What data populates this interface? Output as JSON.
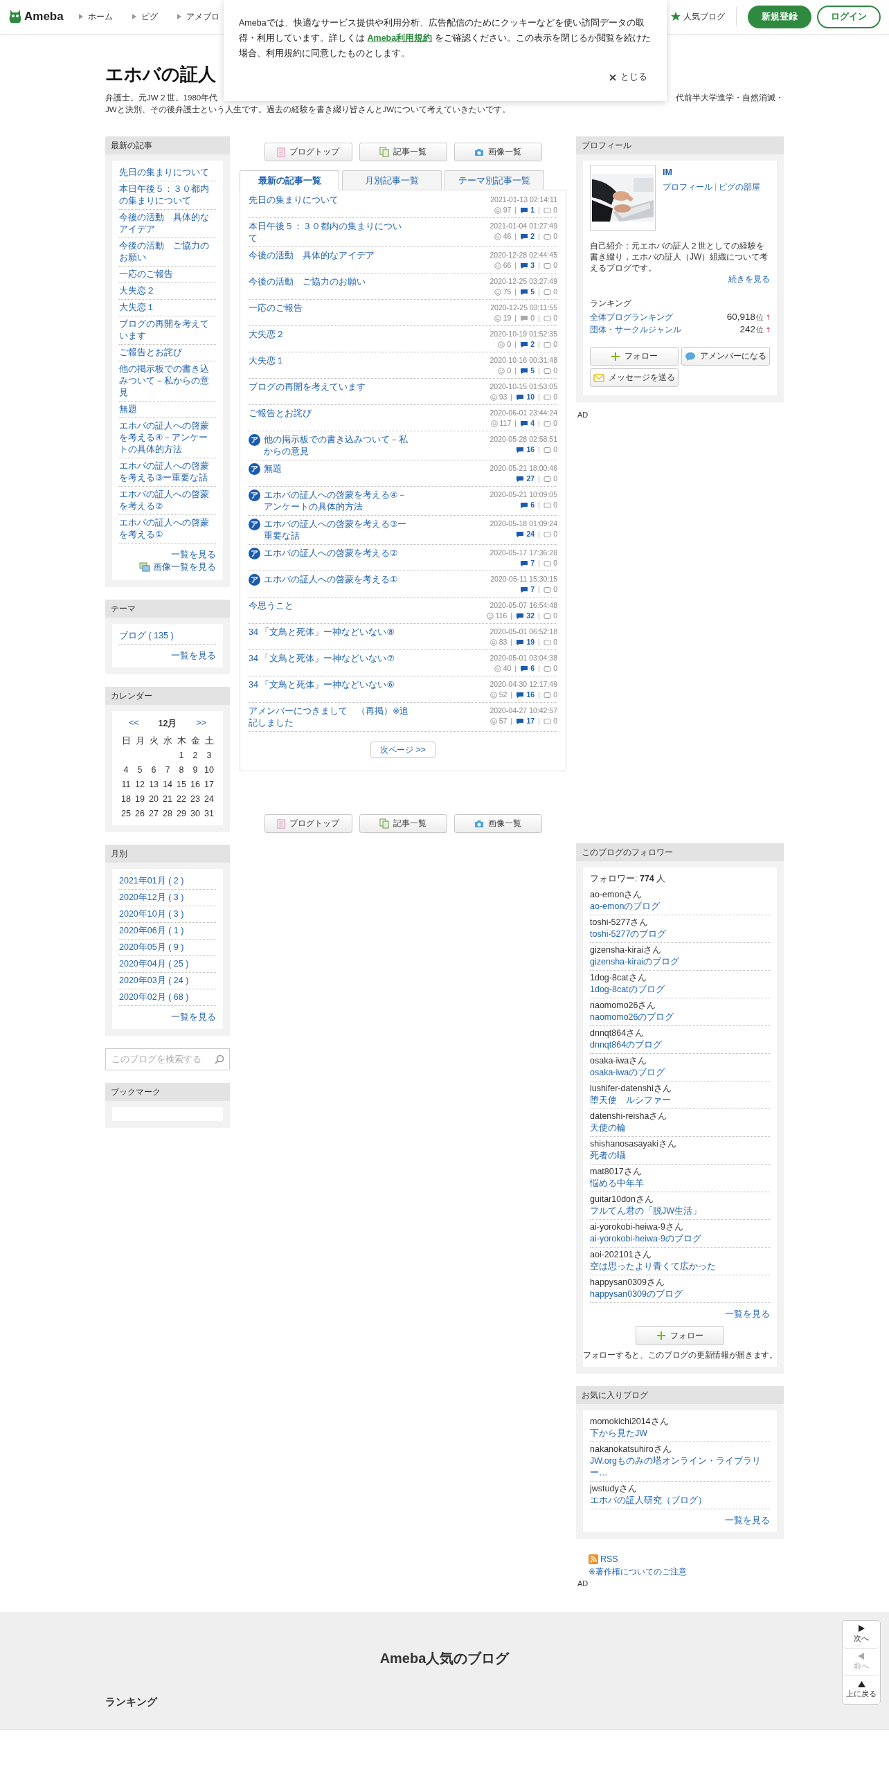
{
  "header": {
    "logo": "Ameba",
    "nav": [
      "ホーム",
      "ピグ",
      "アメブロ"
    ],
    "popular": "人気ブログ",
    "signup": "新規登録",
    "login": "ログイン"
  },
  "cookie_notice": {
    "before": "Amebaでは、快適なサービス提供や利用分析、広告配信のためにクッキーなどを使い訪問データの取得・利用しています。詳しくは ",
    "link": "Ameba利用規約",
    "after": " をご確認ください。この表示を閉じるか閲覧を続けた場合、利用規約に同意したものとします。",
    "close": "とじる"
  },
  "blog": {
    "title": "エホバの証人",
    "description_left": "弁護士。元JW２世。1980年代",
    "description_right": "代前半大学進学・自然消滅・",
    "description_line2": "JWと決別、その後弁護士という人生です。過去の経験を書き綴り皆さんとJWについて考えていきたいです。"
  },
  "recent_articles": {
    "title": "最新の記事",
    "items": [
      "先日の集まりについて",
      "本日午後５：３０都内の集まりについて",
      "今後の活動　具体的なアイデア",
      "今後の活動　ご協力のお願い",
      "一応のご報告",
      "大失恋２",
      "大失恋１",
      "ブログの再開を考えています",
      "ご報告とお詫び",
      "他の掲示板での書き込みついて－私からの意見",
      "無題",
      "エホバの証人への啓蒙を考える④－アンケートの具体的方法",
      "エホバの証人への啓蒙を考える③ー重要な話",
      "エホバの証人への啓蒙を考える②",
      "エホバの証人への啓蒙を考える①"
    ],
    "more": "一覧を見る",
    "image_list": "画像一覧を見る"
  },
  "theme": {
    "title": "テーマ",
    "items": [
      "ブログ ( 135 )"
    ],
    "more": "一覧を見る"
  },
  "calendar": {
    "title": "カレンダー",
    "prev": "<<",
    "month": "12月",
    "next": ">>",
    "weekdays": [
      "日",
      "月",
      "火",
      "水",
      "木",
      "金",
      "土"
    ],
    "weeks": [
      [
        "1",
        "2",
        "3"
      ],
      [
        "4",
        "5",
        "6",
        "7",
        "8",
        "9",
        "10"
      ],
      [
        "11",
        "12",
        "13",
        "14",
        "15",
        "16",
        "17"
      ],
      [
        "18",
        "19",
        "20",
        "21",
        "22",
        "23",
        "24"
      ],
      [
        "25",
        "26",
        "27",
        "28",
        "29",
        "30",
        "31"
      ]
    ]
  },
  "monthly": {
    "title": "月別",
    "items": [
      "2021年01月 ( 2 )",
      "2020年12月 ( 3 )",
      "2020年10月 ( 3 )",
      "2020年06月 ( 1 )",
      "2020年05月 ( 9 )",
      "2020年04月 ( 25 )",
      "2020年03月 ( 24 )",
      "2020年02月 ( 68 )"
    ],
    "more": "一覧を見る"
  },
  "search": {
    "placeholder": "このブログを検索する"
  },
  "bookmark": {
    "title": "ブックマーク"
  },
  "top_buttons": [
    {
      "kind": "top",
      "label": "ブログトップ"
    },
    {
      "kind": "list",
      "label": "記事一覧"
    },
    {
      "label": "画像一覧"
    }
  ],
  "tabs": [
    {
      "label": "最新の記事一覧",
      "selected": true
    },
    {
      "label": "月別記事一覧",
      "selected": false
    },
    {
      "label": "テーマ別記事一覧",
      "selected": false
    }
  ],
  "articles": [
    {
      "title": "先日の集まりについて",
      "date": "2021-01-13 02:14:11",
      "likes": "97",
      "comments": "1",
      "comments_active": true,
      "reblogs": "0"
    },
    {
      "title": "本日午後５：３０都内の集まりについて",
      "date": "2021-01-04 01:27:49",
      "likes": "46",
      "comments": "2",
      "comments_active": true,
      "reblogs": "0"
    },
    {
      "title": "今後の活動　具体的なアイデア",
      "date": "2020-12-28 02:44:45",
      "likes": "66",
      "comments": "3",
      "comments_active": true,
      "reblogs": "0"
    },
    {
      "title": "今後の活動　ご協力のお願い",
      "date": "2020-12-25 03:27:49",
      "likes": "75",
      "comments": "5",
      "comments_active": true,
      "reblogs": "0"
    },
    {
      "title": "一応のご報告",
      "date": "2020-12-25 03:11:55",
      "likes": "19",
      "comments": "0",
      "comments_active": false,
      "reblogs": "0"
    },
    {
      "title": "大失恋２",
      "date": "2020-10-19 01:52:35",
      "likes": "0",
      "comments": "2",
      "comments_active": true,
      "reblogs": "0"
    },
    {
      "title": "大失恋１",
      "date": "2020-10-16 00:31:48",
      "likes": "0",
      "comments": "5",
      "comments_active": true,
      "reblogs": "0"
    },
    {
      "title": "ブログの再開を考えています",
      "date": "2020-10-15 01:53:05",
      "likes": "93",
      "comments": "10",
      "comments_active": true,
      "reblogs": "0"
    },
    {
      "title": "ご報告とお詫び",
      "date": "2020-06-01 23:44:24",
      "likes": "117",
      "comments": "4",
      "comments_active": true,
      "reblogs": "0"
    },
    {
      "badge": "ア",
      "title": "他の掲示板での書き込みついて－私からの意見",
      "date": "2020-05-28 02:58:51",
      "comments": "16",
      "comments_active": true,
      "reblogs": "0"
    },
    {
      "badge": "ア",
      "title": "無題",
      "date": "2020-05-21 18:00:46",
      "comments": "27",
      "comments_active": true,
      "reblogs": "0"
    },
    {
      "badge": "ア",
      "title": "エホバの証人への啓蒙を考える④－アンケートの具体的方法",
      "date": "2020-05-21 10:09:05",
      "comments": "6",
      "comments_active": true,
      "reblogs": "0"
    },
    {
      "badge": "ア",
      "title": "エホバの証人への啓蒙を考える③ー重要な話",
      "date": "2020-05-18 01:09:24",
      "comments": "24",
      "comments_active": true,
      "reblogs": "0"
    },
    {
      "badge": "ア",
      "title": "エホバの証人への啓蒙を考える②",
      "date": "2020-05-17 17:36:28",
      "comments": "7",
      "comments_active": true,
      "reblogs": "0"
    },
    {
      "badge": "ア",
      "title": "エホバの証人への啓蒙を考える①",
      "date": "2020-05-11 15:30:15",
      "comments": "7",
      "comments_active": true,
      "reblogs": "0"
    },
    {
      "title": "今思うこと",
      "date": "2020-05-07 16:54:48",
      "likes": "116",
      "comments": "32",
      "comments_active": true,
      "reblogs": "0"
    },
    {
      "title": "34 「文鳥と死体」ー神などいない⑧",
      "date": "2020-05-01 06:52:18",
      "likes": "83",
      "comments": "19",
      "comments_active": true,
      "reblogs": "0"
    },
    {
      "title": "34 「文鳥と死体」ー神などいない⑦",
      "date": "2020-05-01 03:04:38",
      "likes": "40",
      "comments": "6",
      "comments_active": true,
      "reblogs": "0"
    },
    {
      "title": "34 「文鳥と死体」ー神などいない⑥",
      "date": "2020-04-30 12:17:49",
      "likes": "52",
      "comments": "16",
      "comments_active": true,
      "reblogs": "0"
    },
    {
      "title": "アメンバーにつきまして　（再掲）※追記しました",
      "date": "2020-04-27 10:42:57",
      "likes": "57",
      "comments": "17",
      "comments_active": true,
      "reblogs": "0"
    }
  ],
  "next_page": "次ページ >>",
  "bottom_buttons": [
    {
      "kind": "top",
      "label": "ブログトップ"
    },
    {
      "kind": "list",
      "label": "記事一覧"
    },
    {
      "label": "画像一覧"
    }
  ],
  "profile": {
    "title": "プロフィール",
    "name": "IM",
    "links": [
      "プロフィール",
      "ピグの部屋"
    ],
    "intro": "自己紹介：元エホバの証人２世としての経験を書き綴り，エホバの証人（JW）組織について考えるブログです。",
    "more": "続きを見る",
    "ranking_title": "ランキング",
    "rankings": [
      {
        "label": "全体ブログランキング",
        "rank": "60,918",
        "unit": "位"
      },
      {
        "label": "団体・サークルジャンル",
        "rank": "242",
        "unit": "位"
      }
    ],
    "follow": "フォロー",
    "amember": "アメンバーになる",
    "message": "メッセージを送る",
    "ad": "AD"
  },
  "followers": {
    "title": "このブログのフォロワー",
    "count": "フォロワー: **774** 人",
    "items": [
      {
        "user": "ao-emonさん",
        "blog": "ao-emonのブログ"
      },
      {
        "user": "toshi-5277さん",
        "blog": "toshi-5277のブログ"
      },
      {
        "user": "gizensha-kiraiさん",
        "blog": "gizensha-kiraiのブログ"
      },
      {
        "user": "1dog-8catさん",
        "blog": "1dog-8catのブログ"
      },
      {
        "user": "naomomo26さん",
        "blog": "naomomo26のブログ"
      },
      {
        "user": "dnnqt864さん",
        "blog": "dnnqt864のブログ"
      },
      {
        "user": "osaka-iwaさん",
        "blog": "osaka-iwaのブログ"
      },
      {
        "user": "lushifer-datenshiさん",
        "blog": "堕天使　ルシファー"
      },
      {
        "user": "datenshi-reishaさん",
        "blog": "天使の輪"
      },
      {
        "user": "shishanosasayakiさん",
        "blog": "死者の囁"
      },
      {
        "user": "mat8017さん",
        "blog": "悩める中年羊"
      },
      {
        "user": "guitar10donさん",
        "blog": "フルてん君の「脱JW生活」"
      },
      {
        "user": "ai-yorokobi-heiwa-9さん",
        "blog": "ai-yorokobi-heiwa-9のブログ"
      },
      {
        "user": "aoi-202101さん",
        "blog": "空は思ったより青くて広かった"
      },
      {
        "user": "happysan0309さん",
        "blog": "happysan0309のブログ"
      }
    ],
    "more": "一覧を見る",
    "follow": "フォロー",
    "note": "フォローすると、このブログの更新情報が届きます。"
  },
  "favorites": {
    "title": "お気に入りブログ",
    "items": [
      {
        "user": "momokichi2014さん",
        "blog": "下から見たJW"
      },
      {
        "user": "nakanokatsuhiroさん",
        "blog": "JW.orgものみの塔オンライン・ライブラリー…"
      },
      {
        "user": "jwstudyさん",
        "blog": "エホバの証人研究（ブログ）"
      }
    ],
    "more": "一覧を見る"
  },
  "rss": {
    "label": "RSS",
    "copyright": "※著作権についてのご注意",
    "ad": "AD"
  },
  "footer": {
    "title": "Ameba人気のブログ",
    "ranking": "ランキング"
  },
  "float_nav": [
    {
      "kind": "next",
      "label": "次へ",
      "disabled": false
    },
    {
      "kind": "prev",
      "label": "前へ",
      "disabled": true
    },
    {
      "kind": "top",
      "label": "上に戻る",
      "disabled": false
    }
  ]
}
